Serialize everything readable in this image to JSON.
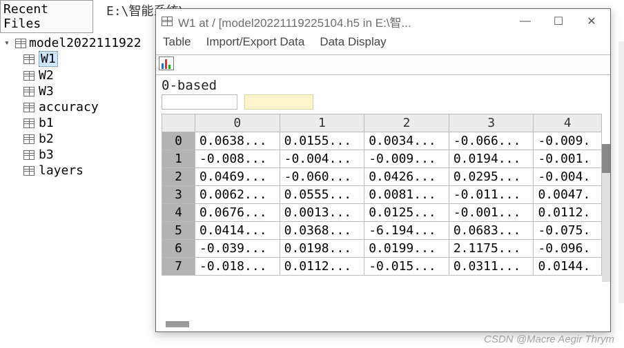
{
  "path_bar": "E:\\智能系统\\...",
  "tree": {
    "header": "Recent Files",
    "root": "model2022111922",
    "items": [
      "W1",
      "W2",
      "W3",
      "accuracy",
      "b1",
      "b2",
      "b3",
      "layers"
    ],
    "selected_index": 0
  },
  "dialog": {
    "title": "W1 at / [model20221119225104.h5 in E:\\智...",
    "menus": [
      "Table",
      "Import/Export Data",
      "Data Display"
    ],
    "basis_label": "0-based",
    "columns": [
      "0",
      "1",
      "2",
      "3",
      "4"
    ],
    "rows": [
      {
        "idx": "0",
        "cells": [
          "0.0638...",
          "0.0155...",
          "0.0034...",
          "-0.066...",
          "-0.009."
        ]
      },
      {
        "idx": "1",
        "cells": [
          "-0.008...",
          "-0.004...",
          "-0.009...",
          "0.0194...",
          "-0.001."
        ]
      },
      {
        "idx": "2",
        "cells": [
          "0.0469...",
          "-0.060...",
          "0.0426...",
          "0.0295...",
          "-0.004."
        ]
      },
      {
        "idx": "3",
        "cells": [
          "0.0062...",
          "0.0555...",
          "0.0081...",
          "-0.011...",
          "0.0047."
        ]
      },
      {
        "idx": "4",
        "cells": [
          "0.0676...",
          "0.0013...",
          "0.0125...",
          "-0.001...",
          "0.0112."
        ]
      },
      {
        "idx": "5",
        "cells": [
          "0.0414...",
          "0.0368...",
          "-6.194...",
          "0.0683...",
          "-0.075."
        ]
      },
      {
        "idx": "6",
        "cells": [
          "-0.039...",
          "0.0198...",
          "0.0199...",
          "2.1175...",
          "-0.096."
        ]
      },
      {
        "idx": "7",
        "cells": [
          "-0.018...",
          "0.0112...",
          "-0.015...",
          "0.0311...",
          "0.0144."
        ]
      }
    ]
  },
  "watermark": "CSDN @Macre Aegir Thrym"
}
